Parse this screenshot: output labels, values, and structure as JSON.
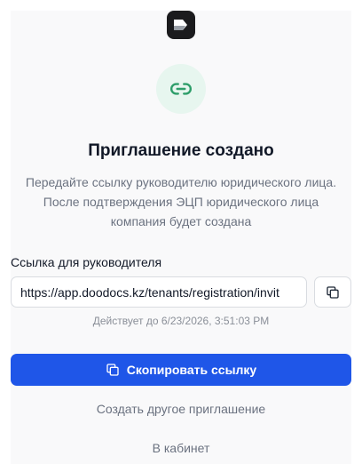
{
  "header": {
    "logo_icon": "app-logo-icon"
  },
  "hero": {
    "icon": "link-icon",
    "icon_color": "#2e9e6a",
    "icon_bg": "#e7f6ef"
  },
  "content": {
    "title": "Приглашение создано",
    "description_lines": [
      "Передайте ссылку руководителю юридического лица.",
      "После подтверждения ЭЦП юридического лица",
      "компания будет создана"
    ]
  },
  "link_field": {
    "label": "Ссылка для руководителя",
    "value": "https://app.doodocs.kz/tenants/registration/invit",
    "copy_icon": "copy-icon"
  },
  "validity": {
    "text": "Действует до 6/23/2026, 3:51:03 PM"
  },
  "actions": {
    "copy_link_label": "Скопировать ссылку",
    "copy_link_icon": "copy-icon",
    "primary_color": "#1f56e8",
    "create_another_label": "Создать другое приглашение",
    "to_cabinet_label": "В кабинет"
  }
}
